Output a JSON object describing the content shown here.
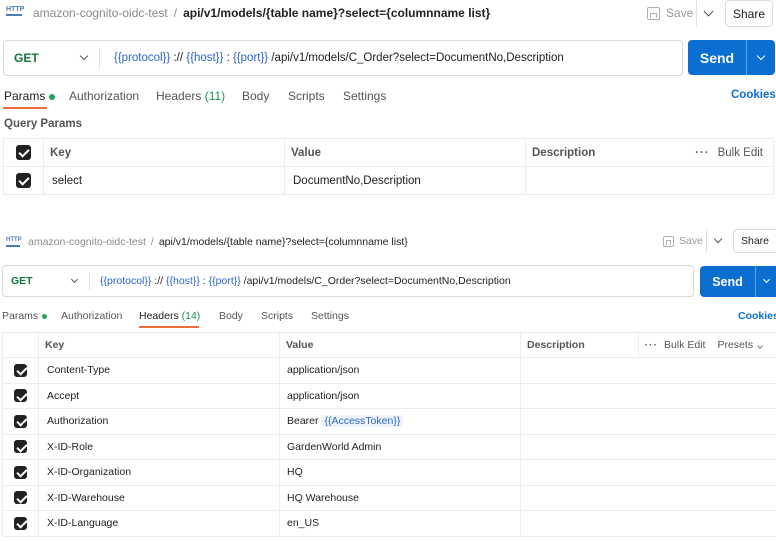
{
  "panel1": {
    "breadcrumb": {
      "collection": "amazon-cognito-oidc-test",
      "separator": "/",
      "request": "api/v1/models/{table name}?select={columnname list}"
    },
    "save_label": "Save",
    "share_label": "Share",
    "method": "GET",
    "url": {
      "protocol_var": "{{protocol}}",
      "sep1": " :// ",
      "host_var": "{{host}}",
      "sep2": " : ",
      "port_var": "{{port}}",
      "path": " /api/v1/models/C_Order?select=DocumentNo,Description"
    },
    "send_label": "Send",
    "tabs": {
      "params": "Params",
      "authorization": "Authorization",
      "headers": "Headers",
      "headers_count": "(11)",
      "body": "Body",
      "scripts": "Scripts",
      "settings": "Settings"
    },
    "cookies_label": "Cookies",
    "query_params_title": "Query Params",
    "table": {
      "columns": {
        "key": "Key",
        "value": "Value",
        "description": "Description"
      },
      "bulk_edit": "Bulk Edit",
      "rows": [
        {
          "key": "select",
          "value": "DocumentNo,Description",
          "description": ""
        }
      ]
    }
  },
  "panel2": {
    "breadcrumb": {
      "collection": "amazon-cognito-oidc-test",
      "separator": "/",
      "request": "api/v1/models/{table name}?select={columnname list}"
    },
    "save_label": "Save",
    "share_label": "Share",
    "method": "GET",
    "url": {
      "protocol_var": "{{protocol}}",
      "sep1": " :// ",
      "host_var": "{{host}}",
      "sep2": " : ",
      "port_var": "{{port}}",
      "path": " /api/v1/models/C_Order?select=DocumentNo,Description"
    },
    "send_label": "Send",
    "tabs": {
      "params": "Params",
      "authorization": "Authorization",
      "headers": "Headers",
      "headers_count": "(14)",
      "body": "Body",
      "scripts": "Scripts",
      "settings": "Settings"
    },
    "cookies_label": "Cookies",
    "table": {
      "columns": {
        "key": "Key",
        "value": "Value",
        "description": "Description"
      },
      "bulk_edit": "Bulk Edit",
      "presets": "Presets",
      "rows": [
        {
          "key": "Content-Type",
          "value": "application/json",
          "description": ""
        },
        {
          "key": "Accept",
          "value": "application/json",
          "description": ""
        },
        {
          "key": "Authorization",
          "value_prefix": "Bearer ",
          "value_var": "{{AccessToken}}",
          "description": ""
        },
        {
          "key": "X-ID-Role",
          "value": "GardenWorld Admin",
          "description": ""
        },
        {
          "key": "X-ID-Organization",
          "value": "HQ",
          "description": ""
        },
        {
          "key": "X-ID-Warehouse",
          "value": "HQ Warehouse",
          "description": ""
        },
        {
          "key": "X-ID-Language",
          "value": "en_US",
          "description": ""
        }
      ]
    }
  },
  "colors": {
    "send_blue": "#0b6fd1",
    "get_green": "#0b7a36",
    "variable_blue": "#2a66c9",
    "active_tab_underline": "#f26b3a",
    "status_dot": "#22a355"
  },
  "icons": [
    "http-icon",
    "save-icon",
    "chevron-down-icon",
    "checkbox-checked-icon",
    "more-dots-icon"
  ]
}
